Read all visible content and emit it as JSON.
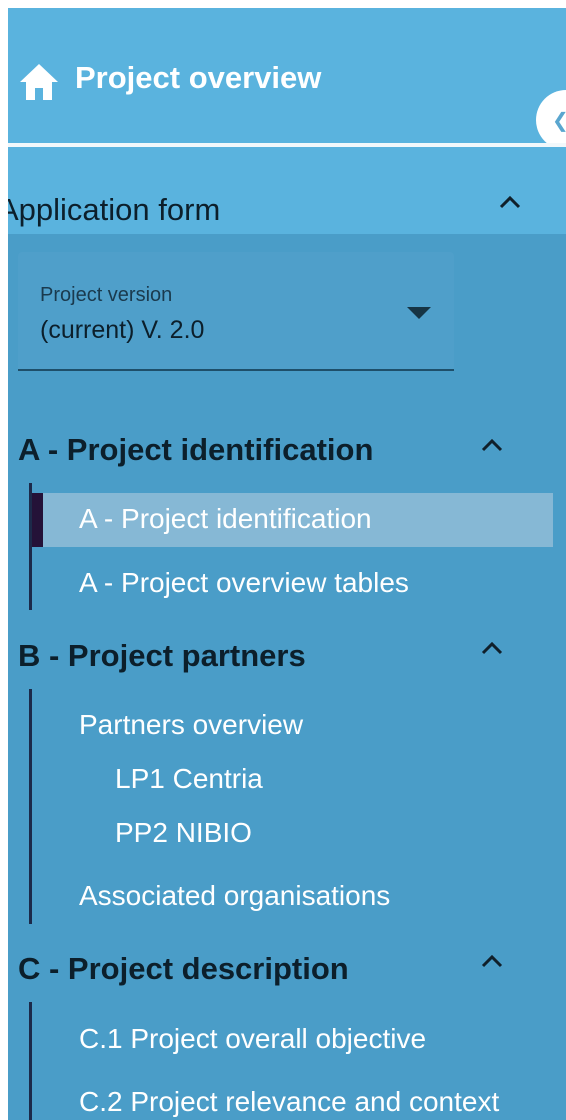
{
  "header": {
    "title": "Project overview",
    "home_icon": "home-icon",
    "collapse_icon": "chevron-left-icon"
  },
  "application_form": {
    "title": "Application form",
    "project_version": {
      "label": "Project version",
      "value": "(current) V. 2.0"
    }
  },
  "groups": [
    {
      "title": "A - Project identification",
      "items": [
        {
          "label": "A - Project identification",
          "active": true
        },
        {
          "label": "A - Project overview tables"
        }
      ]
    },
    {
      "title": "B - Project partners",
      "items": [
        {
          "label": "Partners overview"
        },
        {
          "label": "LP1 Centria",
          "level": 2
        },
        {
          "label": "PP2 NIBIO",
          "level": 2
        },
        {
          "label": "Associated organisations"
        }
      ]
    },
    {
      "title": "C - Project description",
      "items": [
        {
          "label": "C.1 Project overall objective"
        },
        {
          "label": "C.2 Project relevance and context"
        }
      ]
    }
  ],
  "colors": {
    "header_bg": "#5ab3de",
    "panel_bg": "#4a9dc8",
    "active_bg": "#86b8d5",
    "active_marker": "#241238"
  }
}
